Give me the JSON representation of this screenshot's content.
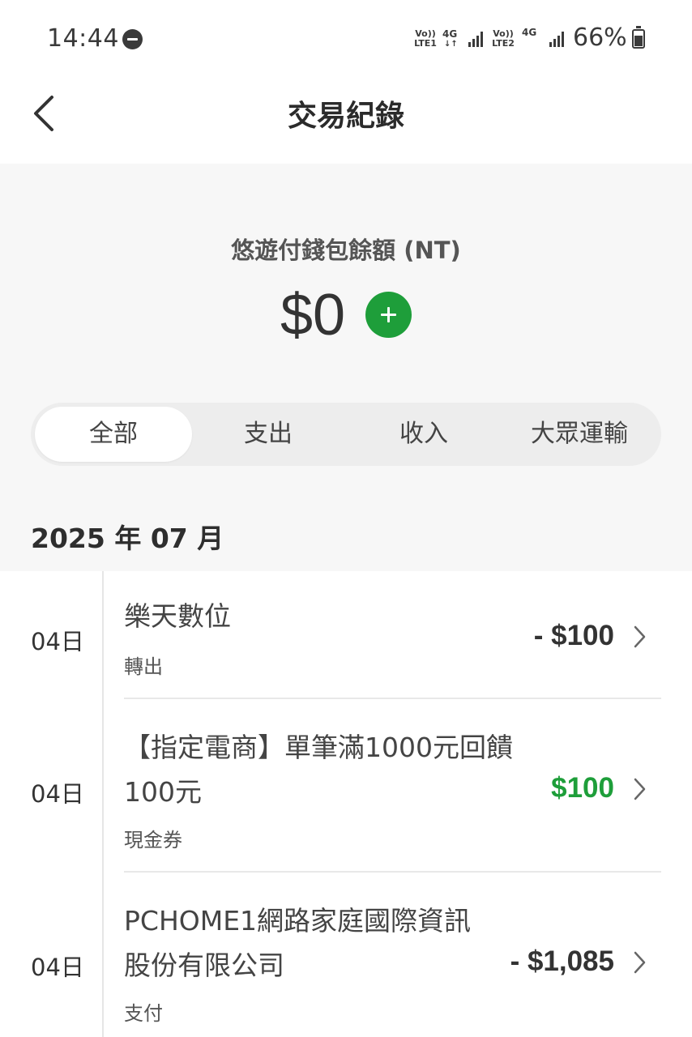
{
  "status_bar": {
    "time": "14:44",
    "sim1_volte": "Vo)) LTE1",
    "sim1_network": "4G",
    "sim2_volte": "Vo)) LTE2",
    "sim2_network": "4G",
    "battery": "66%"
  },
  "header": {
    "title": "交易紀錄"
  },
  "wallet": {
    "label": "悠遊付錢包餘額 (NT)",
    "balance": "$0"
  },
  "tabs": [
    {
      "label": "全部",
      "active": true
    },
    {
      "label": "支出",
      "active": false
    },
    {
      "label": "收入",
      "active": false
    },
    {
      "label": "大眾運輸",
      "active": false
    }
  ],
  "month": "2025 年 07 月",
  "transactions": [
    {
      "date": "04日",
      "title": "樂天數位",
      "subtitle": "轉出",
      "amount": "- $100",
      "type": "expense"
    },
    {
      "date": "04日",
      "title": "【指定電商】單筆滿1000元回饋100元",
      "subtitle": "現金券",
      "amount": "$100",
      "type": "income"
    },
    {
      "date": "04日",
      "title": "PCHOME1網路家庭國際資訊股份有限公司",
      "subtitle": "支付",
      "amount": "- $1,085",
      "type": "expense"
    }
  ],
  "colors": {
    "accent_green": "#1e9e3a",
    "background_gray": "#f7f7f7"
  }
}
